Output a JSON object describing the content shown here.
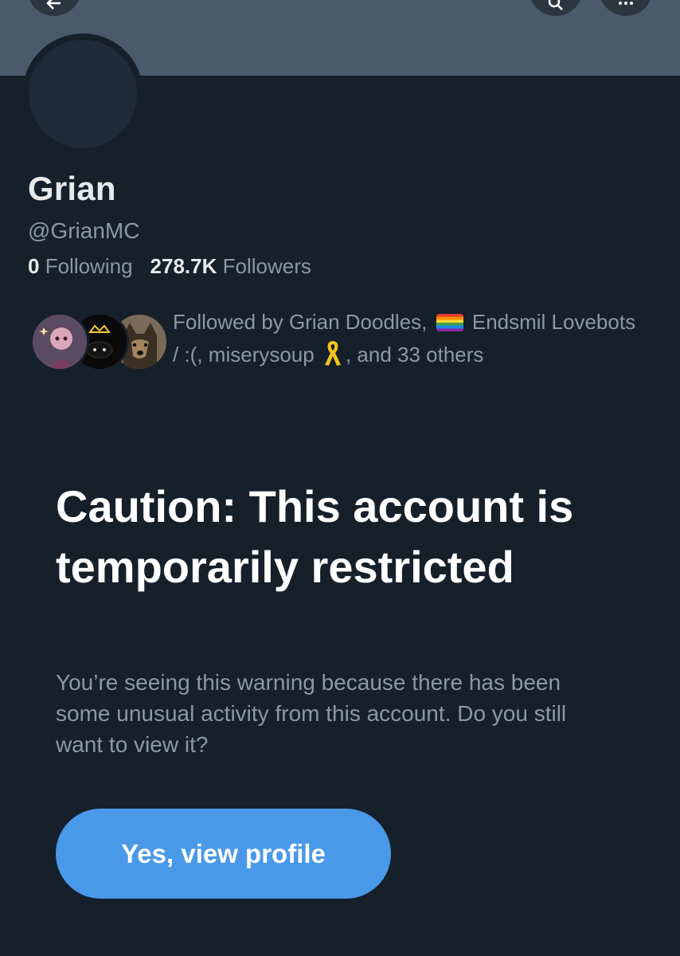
{
  "profile": {
    "display_name": "Grian",
    "handle": "@GrianMC",
    "following_count": "0",
    "following_label": "Following",
    "followers_count": "278.7K",
    "followers_label": "Followers"
  },
  "followed_by": {
    "prefix": "Followed by Grian Doodles,",
    "name2_flag_icon": "rainbow-flag-icon",
    "name2": "Endsmil Lovebots / :(,",
    "name3": "miserysoup",
    "name3_ribbon_icon": "yellow-ribbon-icon",
    "suffix": ", and 33 others"
  },
  "warning": {
    "title": "Caution: This account is temporarily restricted",
    "description": "You’re seeing this warning because there has been some unusual activity from this account. Do you still want to view it?",
    "button_label": "Yes, view profile"
  },
  "colors": {
    "background": "#15202b",
    "banner": "#4b5a6b",
    "primary_text": "#e7e9ea",
    "secondary_text": "#8b98a5",
    "button": "#4a99e9"
  }
}
